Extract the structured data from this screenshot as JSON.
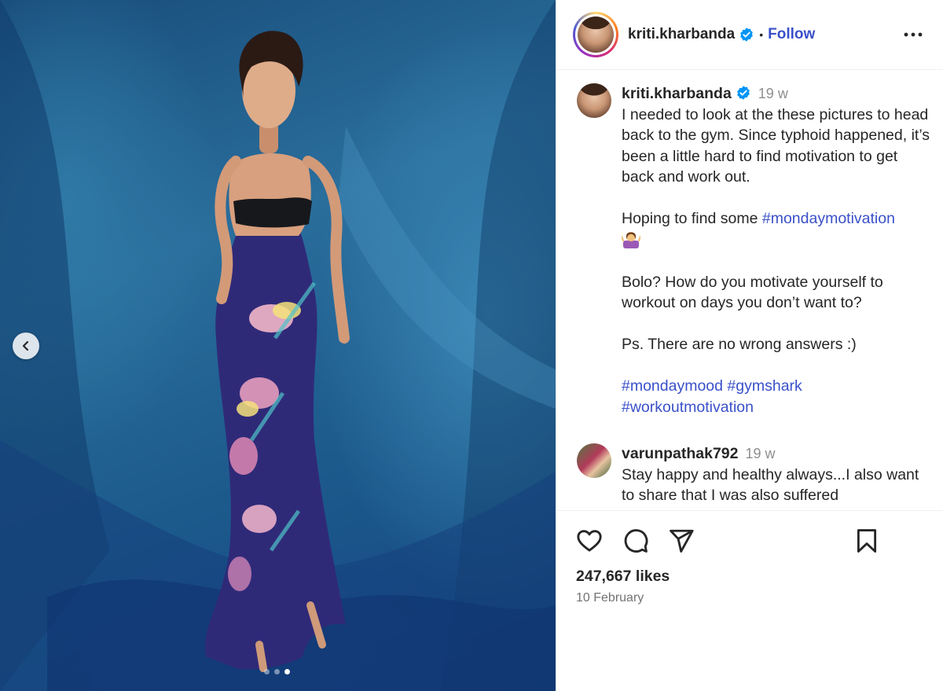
{
  "media": {
    "current_slide": 3,
    "total_slides": 3
  },
  "header": {
    "username": "kriti.kharbanda",
    "separator": "•",
    "follow_label": "Follow"
  },
  "caption": {
    "username": "kriti.kharbanda",
    "time": "19 w",
    "line1": "I needed to look at the these pictures to head back to the gym. Since typhoid happened, it’s been a little hard to find motivation to get back and work out.",
    "line2_prefix": "Hoping to find some ",
    "line2_tag": "#mondaymotivation",
    "line2_emoji": "woman-shrugging-emoji",
    "line3": "Bolo? How do you motivate yourself to workout on days you don’t want to?",
    "line4": "Ps. There are no wrong answers :)",
    "tags": [
      "#mondaymood",
      "#gymshark",
      "#workoutmotivation"
    ]
  },
  "comment": {
    "username": "varunpathak792",
    "time": "19 w",
    "text": "Stay happy and healthy always...I also want to share that I was also suffered"
  },
  "actions": {
    "like_icon": "heart-icon",
    "comment_icon": "comment-icon",
    "share_icon": "send-icon",
    "save_icon": "bookmark-icon"
  },
  "likes": "247,667 likes",
  "date": "10 February",
  "colors": {
    "link": "#3a50c9",
    "verified": "#0095f6",
    "muted": "#8e8e8e"
  }
}
